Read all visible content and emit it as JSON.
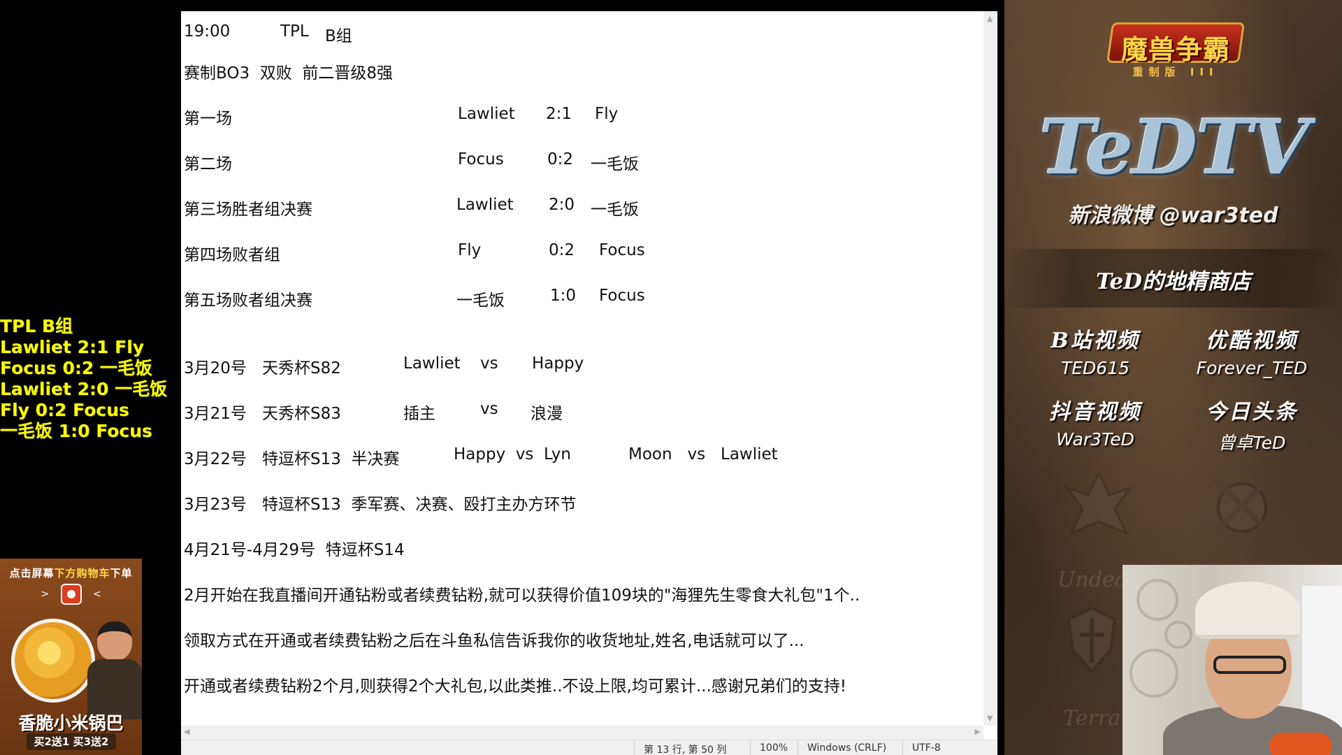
{
  "score_overlay": [
    "TPL B组",
    "Lawliet 2:1 Fly",
    "Focus 0:2 一毛饭",
    "Lawliet 2:0 一毛饭",
    "Fly 0:2 Focus",
    "一毛饭 1:0 Focus"
  ],
  "promo": {
    "top_text_prefix": "点击屏幕",
    "top_text_highlight": "下方购物车",
    "top_text_suffix": "下单",
    "arrow_left": ">",
    "arrow_right": "<",
    "title": "香脆小米锅巴",
    "subtitle": "买2送1 买3送2"
  },
  "notepad": {
    "header": {
      "time": "19:00",
      "event": "TPL",
      "group": "B组"
    },
    "format_line": "赛制BO3  双败  前二晋级8强",
    "matches": [
      {
        "label": "第一场",
        "p1": "Lawliet",
        "score": "2:1",
        "p2": "Fly"
      },
      {
        "label": "第二场",
        "p1": "Focus",
        "score": "0:2",
        "p2": "一毛饭"
      },
      {
        "label": "第三场胜者组决赛",
        "p1": "Lawliet",
        "score": "2:0",
        "p2": "一毛饭"
      },
      {
        "label": "第四场败者组",
        "p1": "Fly",
        "score": "0:2",
        "p2": "Focus"
      },
      {
        "label": "第五场败者组决赛",
        "p1": "一毛饭",
        "score": "1:0",
        "p2": "Focus"
      }
    ],
    "schedule": [
      {
        "date": "3月20号",
        "cup": "天秀杯S82",
        "a": "Lawliet",
        "vs": "vs",
        "b": "Happy"
      },
      {
        "date": "3月21号",
        "cup": "天秀杯S83",
        "a": "插主",
        "vs": "vs",
        "b": "浪漫"
      }
    ],
    "line_322": {
      "date": "3月22号",
      "cup": "特逗杯S13  半决赛",
      "m1": "Happy  vs  Lyn",
      "m2": "Moon   vs   Lawliet"
    },
    "line_323": {
      "date": "3月23号",
      "rest": "特逗杯S13  季军赛、决赛、殴打主办方环节"
    },
    "line_421": "4月21号-4月29号  特逗杯S14",
    "notices": [
      "2月开始在我直播间开通钻粉或者续费钻粉,就可以获得价值109块的\"海狸先生零食大礼包\"1个..",
      "领取方式在开通或者续费钻粉之后在斗鱼私信告诉我你的收货地址,姓名,电话就可以了...",
      "开通或者续费钻粉2个月,则获得2个大礼包,以此类推..不设上限,均可累计...感谢兄弟们的支持!"
    ],
    "status": {
      "position": "第 13 行, 第 50 列",
      "zoom": "100%",
      "line_ending": "Windows (CRLF)",
      "encoding": "UTF-8"
    }
  },
  "right_panel": {
    "game_logo": "魔兽争霸",
    "game_logo_sub": "重制版",
    "game_logo_numeral": "III",
    "channel": "TeDTV",
    "weibo": "新浪微博 @war3ted",
    "shop": "TeD的地精商店",
    "socials": [
      {
        "label": "B站视频",
        "value": "TED615"
      },
      {
        "label": "优酷视频",
        "value": "Forever_TED"
      },
      {
        "label": "抖音视频",
        "value": "War3TeD"
      },
      {
        "label": "今日头条",
        "value": "曾卓TeD"
      }
    ],
    "faded": [
      "Undea",
      "Terra"
    ]
  }
}
